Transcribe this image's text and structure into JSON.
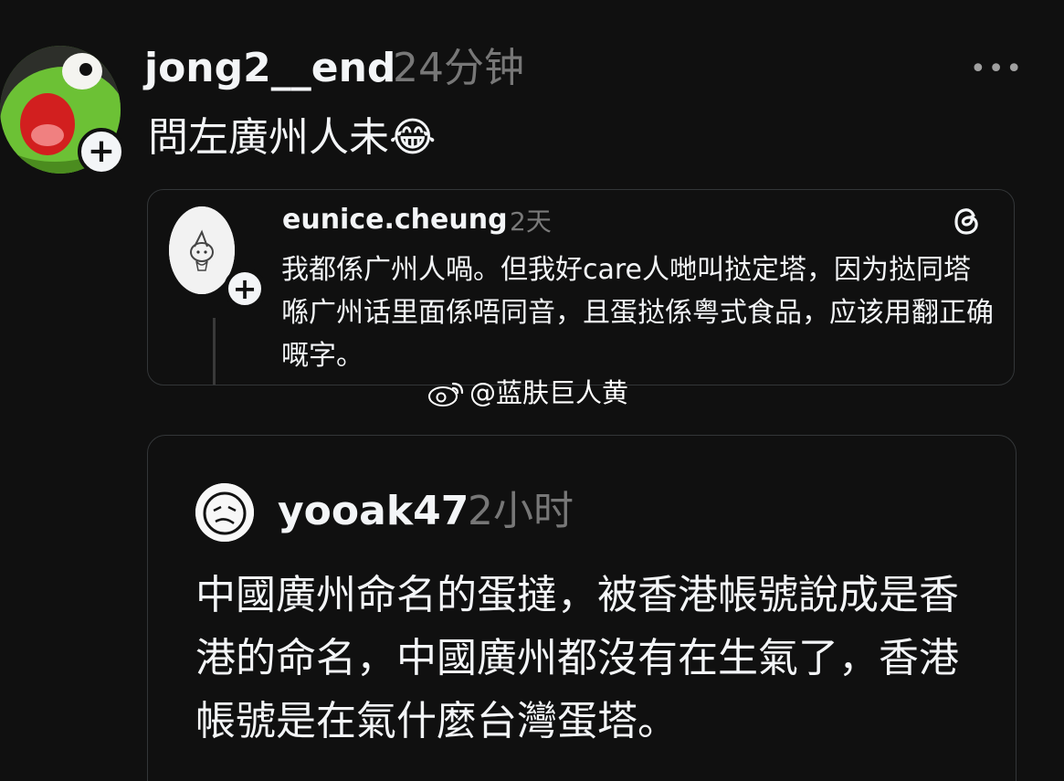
{
  "post": {
    "author": "jong2__end",
    "time": "24分钟",
    "text": "問左廣州人未😂",
    "follow_plus": "+",
    "more": "•••"
  },
  "quote1": {
    "author": "eunice.cheung",
    "time": "2天",
    "text": "我都係广州人喎。但我好care人哋叫挞定塔，因为挞同塔喺广州话里面係唔同音，且蛋挞係粤式食品，应该用翻正确嘅字。",
    "follow_plus": "+"
  },
  "watermark": {
    "text": "@蓝肤巨人黄"
  },
  "quote2": {
    "author": "yooak47",
    "time": "2小时",
    "text": "中國廣州命名的蛋撻，被香港帳號說成是香港的命名，中國廣州都沒有在生氣了，香港帳號是在氣什麼台灣蛋塔。"
  },
  "colors": {
    "background": "#101010",
    "text_primary": "#f3f5f7",
    "text_secondary": "#777777",
    "card_border": "#333638"
  }
}
